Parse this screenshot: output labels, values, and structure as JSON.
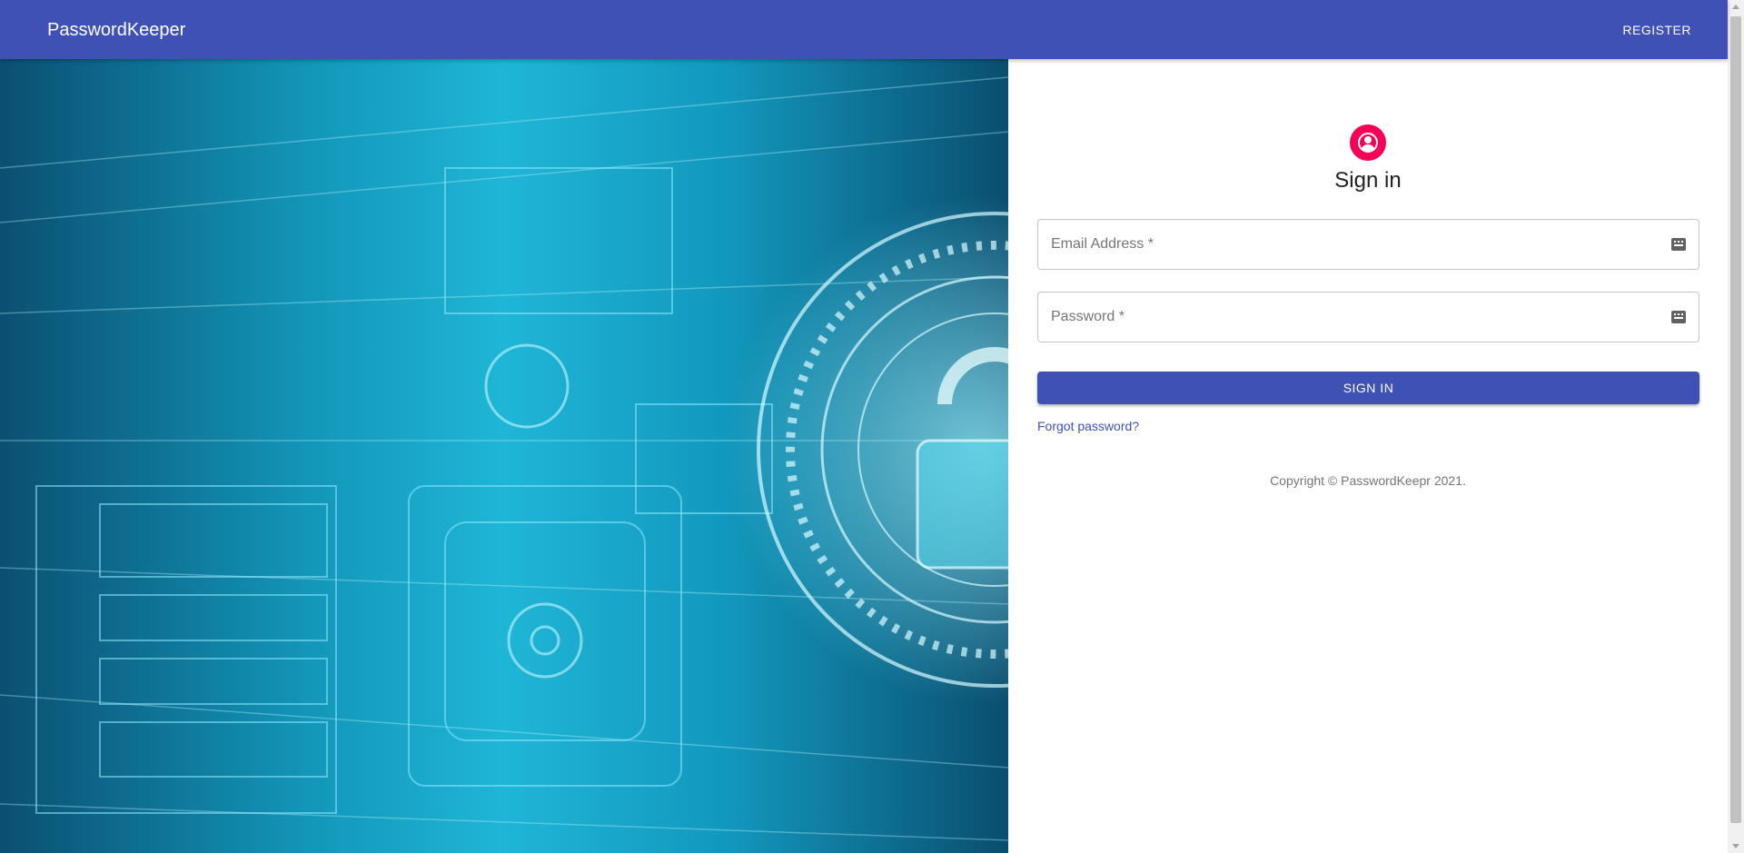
{
  "appbar": {
    "brand": "PasswordKeeper",
    "register_label": "REGISTER"
  },
  "hero": {
    "icon": "cyber-security-lock-image"
  },
  "signin": {
    "avatar_icon": "person-icon",
    "title": "Sign in",
    "email_placeholder": "Email Address *",
    "email_value": "",
    "password_placeholder": "Password *",
    "password_value": "",
    "field_icon": "keyboard-icon",
    "button_label": "SIGN IN",
    "forgot_label": "Forgot password?",
    "copyright": "Copyright © PasswordKeepr 2021."
  },
  "colors": {
    "primary": "#3f51b5",
    "accent": "#f50057",
    "hero_cyan": "#1fb6d6"
  }
}
